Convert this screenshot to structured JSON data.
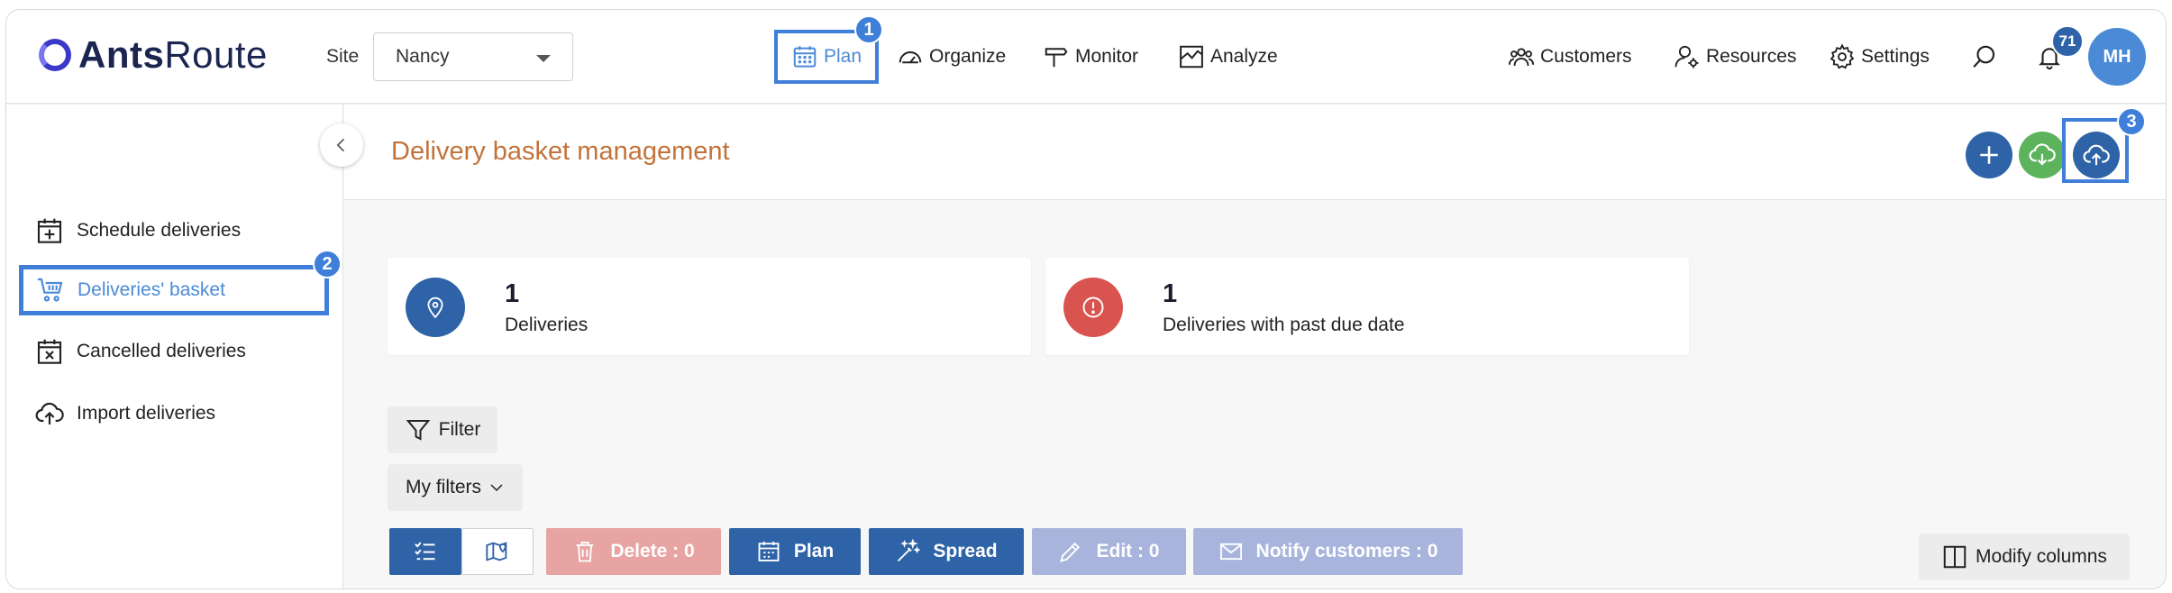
{
  "app": {
    "logo_bold": "Ants",
    "logo_light": "Route"
  },
  "header": {
    "site_label": "Site",
    "site_value": "Nancy",
    "nav": [
      {
        "label": "Plan",
        "icon": "calendar-icon"
      },
      {
        "label": "Organize",
        "icon": "speedometer-icon"
      },
      {
        "label": "Monitor",
        "icon": "signpost-icon"
      },
      {
        "label": "Analyze",
        "icon": "chart-icon"
      }
    ],
    "right_nav": [
      {
        "label": "Customers",
        "icon": "customers-icon"
      },
      {
        "label": "Resources",
        "icon": "resources-icon"
      },
      {
        "label": "Settings",
        "icon": "gear-icon"
      }
    ],
    "notification_count": "71",
    "avatar_initials": "MH"
  },
  "annotations": {
    "step1": "1",
    "step2": "2",
    "step3": "3"
  },
  "sidebar": {
    "items": [
      {
        "label": "Schedule deliveries",
        "icon": "calendar-plus-icon",
        "active": false
      },
      {
        "label": "Deliveries' basket",
        "icon": "basket-icon",
        "active": true
      },
      {
        "label": "Cancelled deliveries",
        "icon": "calendar-x-icon",
        "active": false
      },
      {
        "label": "Import deliveries",
        "icon": "cloud-upload-icon",
        "active": false
      }
    ]
  },
  "main": {
    "title": "Delivery basket management",
    "cards": [
      {
        "value": "1",
        "label": "Deliveries",
        "color": "#2f63a7",
        "icon": "location-pin-icon"
      },
      {
        "value": "1",
        "label": "Deliveries with past due date",
        "color": "#d9534f",
        "icon": "alert-icon"
      }
    ],
    "filter_label": "Filter",
    "my_filters_label": "My filters",
    "toolbar": {
      "delete_label": "Delete : 0",
      "plan_label": "Plan",
      "spread_label": "Spread",
      "edit_label": "Edit : 0",
      "notify_label": "Notify customers : 0",
      "modify_columns_label": "Modify columns"
    }
  },
  "colors": {
    "primary": "#2f63a7",
    "accent_blue": "#3f7fd9",
    "green": "#5cb35c",
    "danger": "#d9534f",
    "title_orange": "#c2733a"
  }
}
